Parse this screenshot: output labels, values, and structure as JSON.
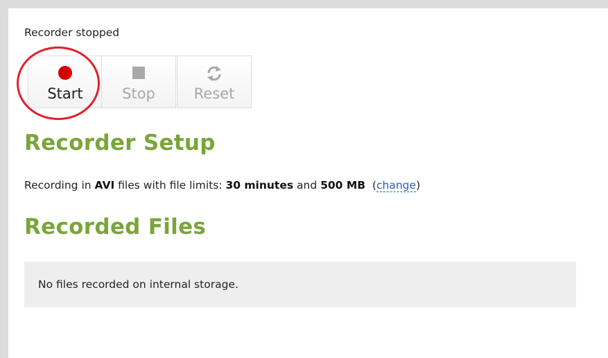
{
  "recorder": {
    "status_text": "Recorder stopped",
    "buttons": {
      "start_label": "Start",
      "stop_label": "Stop",
      "reset_label": "Reset"
    }
  },
  "setup": {
    "heading": "Recorder Setup",
    "line_prefix": "Recording in ",
    "format": "AVI",
    "line_middle": " files with file limits: ",
    "time_limit": "30 minutes",
    "and_word": " and ",
    "size_limit": "500 MB",
    "open_paren": "  (",
    "change_link": "change",
    "close_paren": ")"
  },
  "files": {
    "heading": "Recorded Files",
    "empty_message": "No files recorded on internal storage."
  },
  "colors": {
    "heading_green": "#7aa53a",
    "record_red": "#d40000",
    "highlight_ring": "#e0202a",
    "link_blue": "#2a5db0",
    "disabled_gray": "#a8a8a8"
  },
  "icons": {
    "start": "record-dot-icon",
    "stop": "stop-square-icon",
    "reset": "reset-arrows-icon"
  }
}
